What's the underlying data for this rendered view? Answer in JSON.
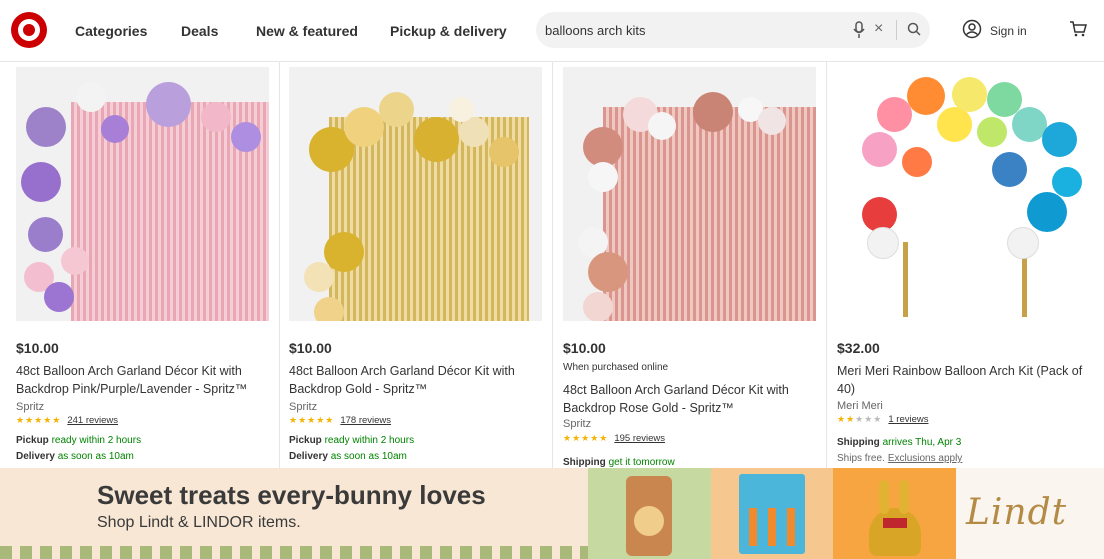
{
  "header": {
    "logo": "target-bullseye-logo",
    "nav": [
      "Categories",
      "Deals",
      "New & featured",
      "Pickup & delivery"
    ],
    "search_value": "balloons arch kits",
    "sign_in": "Sign in"
  },
  "colors": {
    "brand": "#cc0000",
    "star": "#f5b301",
    "ok_green": "#008300"
  },
  "products": [
    {
      "price": "$10.00",
      "title": "48ct Balloon Arch Garland Décor Kit with Backdrop Pink/Purple/Lavender - Spritz™",
      "brand": "Spritz",
      "rating": 5,
      "reviews": "241 reviews",
      "f1_label": "Pickup",
      "f1_value": "ready within 2 hours",
      "f2_label": "Delivery",
      "f2_value": "as soon as 10am"
    },
    {
      "price": "$10.00",
      "title": "48ct Balloon Arch Garland Décor Kit with Backdrop Gold - Spritz™",
      "brand": "Spritz",
      "rating": 5,
      "reviews": "178 reviews",
      "f1_label": "Pickup",
      "f1_value": "ready within 2 hours",
      "f2_label": "Delivery",
      "f2_value": "as soon as 10am"
    },
    {
      "price": "$10.00",
      "note": "When purchased online",
      "title": "48ct Balloon Arch Garland Décor Kit with Backdrop Rose Gold - Spritz™",
      "brand": "Spritz",
      "rating": 5,
      "reviews": "195 reviews",
      "f1_label": "Shipping",
      "f1_value": "get it tomorrow"
    },
    {
      "price": "$32.00",
      "title": "Meri Meri Rainbow Balloon Arch Kit (Pack of 40)",
      "brand": "Meri Meri",
      "rating": 2,
      "reviews": "1 reviews",
      "f1_label": "Shipping",
      "f1_value": "arrives Thu, Apr 3",
      "f2_plain": "Ships free.",
      "f2_link": "Exclusions apply"
    }
  ],
  "banner": {
    "headline": "Sweet treats every-bunny loves",
    "subline": "Shop Lindt & LINDOR items.",
    "logo": "Lindt"
  }
}
